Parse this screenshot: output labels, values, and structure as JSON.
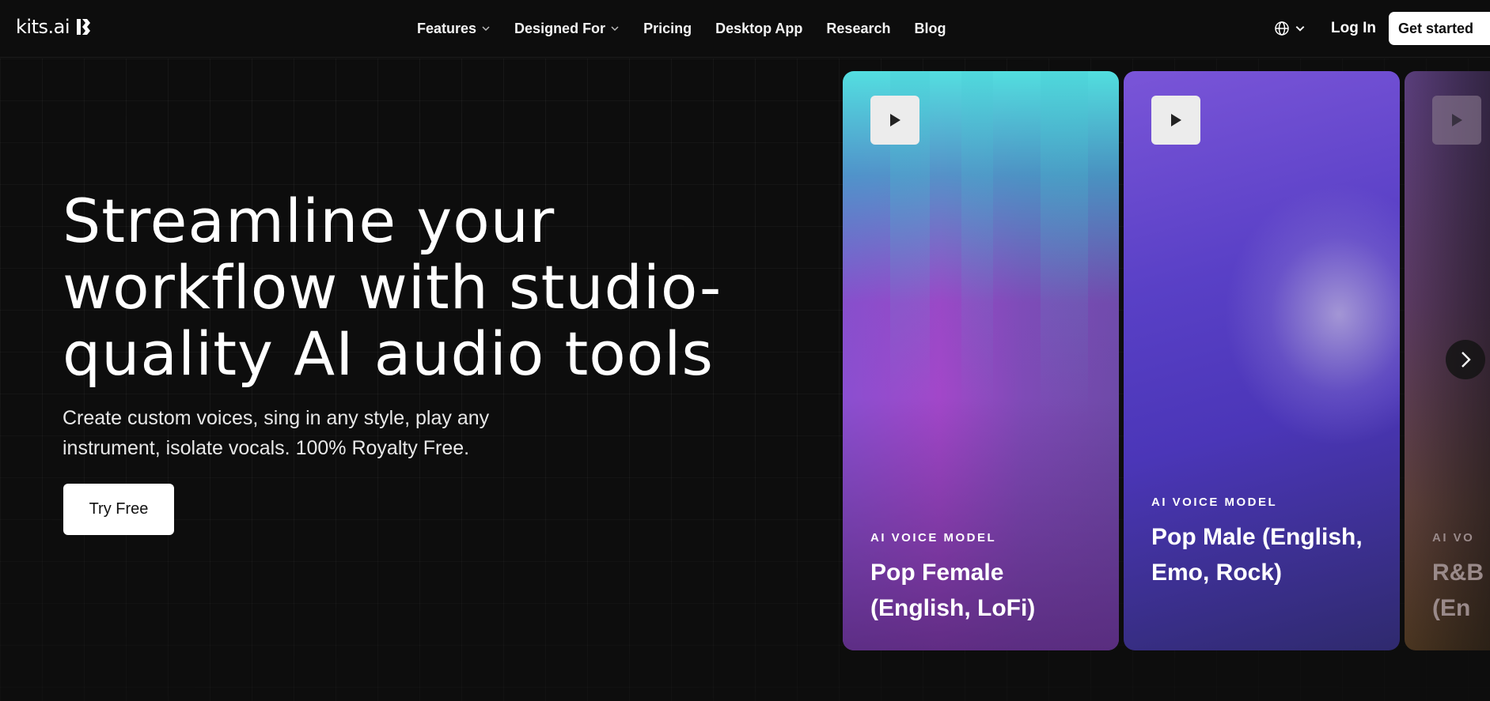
{
  "header": {
    "logo_text": "kits.ai",
    "nav": [
      {
        "label": "Features",
        "has_dropdown": true
      },
      {
        "label": "Designed For",
        "has_dropdown": true
      },
      {
        "label": "Pricing",
        "has_dropdown": false
      },
      {
        "label": "Desktop App",
        "has_dropdown": false
      },
      {
        "label": "Research",
        "has_dropdown": false
      },
      {
        "label": "Blog",
        "has_dropdown": false
      }
    ],
    "language_icon": "globe-icon",
    "login_label": "Log In",
    "get_started_label": "Get started"
  },
  "hero": {
    "title": "Streamline your workflow with studio-quality AI audio tools",
    "subtitle": "Create custom voices, sing in any style, play any instrument, isolate vocals. 100% Royalty Free.",
    "cta_label": "Try Free"
  },
  "cards": [
    {
      "label": "AI VOICE MODEL",
      "title": "Pop Female (English, LoFi)",
      "icon": "play-icon"
    },
    {
      "label": "AI VOICE MODEL",
      "title": "Pop Male (English, Emo, Rock)",
      "icon": "play-icon"
    },
    {
      "label": "AI VO",
      "title": "R&B (En",
      "icon": "play-icon"
    }
  ],
  "carousel": {
    "next_icon": "chevron-right-icon"
  },
  "colors": {
    "background": "#0d0d0d",
    "text": "#ffffff",
    "button_bg": "#ffffff"
  }
}
